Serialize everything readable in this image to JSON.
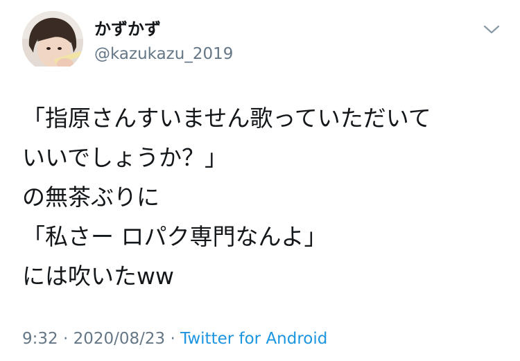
{
  "author": {
    "display_name": "かずかず",
    "handle": "@kazukazu_2019"
  },
  "tweet": {
    "lines": [
      "「指原さんすいません歌っていただいて",
      "いいでしょうか？」",
      "の無茶ぶりに",
      "「私さー ロパク専門なんよ」",
      "には吹いたww"
    ]
  },
  "meta": {
    "time": "9:32",
    "separator": " · ",
    "date": "2020/08/23",
    "source": "Twitter for Android"
  },
  "icons": {
    "menu": "chevron-down-icon",
    "avatar": "user-avatar-photo"
  },
  "colors": {
    "text": "#14171a",
    "secondary": "#657786",
    "link": "#1b95e0"
  }
}
